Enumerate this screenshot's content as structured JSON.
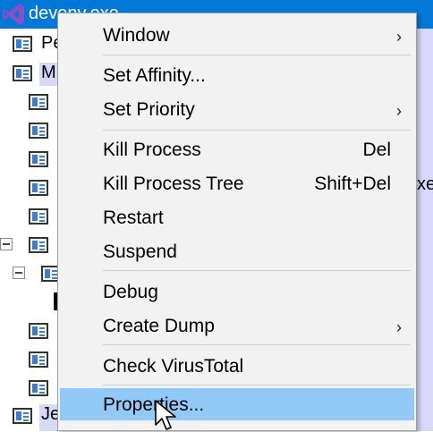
{
  "tree": {
    "selected_process": "devenv.exe",
    "rows": [
      {
        "label": "Pe"
      },
      {
        "label": "M"
      },
      {
        "label": "Je"
      }
    ],
    "right_fragment": "xe"
  },
  "menu": {
    "items": {
      "window": {
        "label": "Window",
        "arrow": "›"
      },
      "set_affinity": {
        "label": "Set Affinity..."
      },
      "set_priority": {
        "label": "Set Priority",
        "arrow": "›"
      },
      "kill_process": {
        "label": "Kill Process",
        "shortcut": "Del"
      },
      "kill_process_tree": {
        "label": "Kill Process Tree",
        "shortcut": "Shift+Del"
      },
      "restart": {
        "label": "Restart"
      },
      "suspend": {
        "label": "Suspend"
      },
      "debug": {
        "label": "Debug"
      },
      "create_dump": {
        "label": "Create Dump",
        "arrow": "›"
      },
      "check_virustotal": {
        "label": "Check VirusTotal"
      },
      "properties": {
        "label": "Properties..."
      }
    }
  },
  "colors": {
    "selection": "#0078d7",
    "menu_highlight": "#91c9f7",
    "menu_background": "#f2f2f2",
    "tree_highlight": "#d8d8fb"
  },
  "icons": [
    "visual-studio-icon",
    "process-icon",
    "collapse-icon",
    "chevron-right-icon",
    "mouse-cursor-icon"
  ]
}
